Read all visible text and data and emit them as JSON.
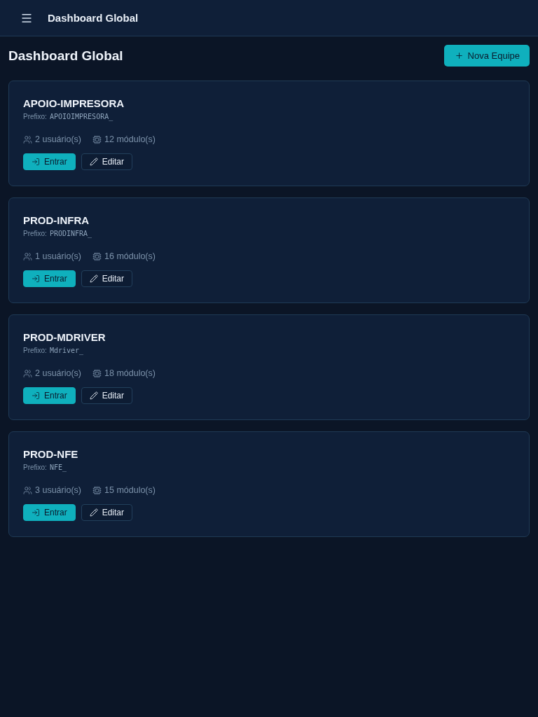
{
  "header": {
    "title": "Dashboard Global"
  },
  "page": {
    "title": "Dashboard Global",
    "new_button": "Nova Equipe"
  },
  "teams": [
    {
      "name": "APOIO-IMPRESORA",
      "prefix_label": "Prefixo:",
      "prefix": "APOIOIMPRESORA_",
      "users": "2 usuário(s)",
      "modules": "12 módulo(s)",
      "enter": "Entrar",
      "edit": "Editar"
    },
    {
      "name": "PROD-INFRA",
      "prefix_label": "Prefixo:",
      "prefix": "PRODINFRA_",
      "users": "1 usuário(s)",
      "modules": "16 módulo(s)",
      "enter": "Entrar",
      "edit": "Editar"
    },
    {
      "name": "PROD-MDRIVER",
      "prefix_label": "Prefixo:",
      "prefix": "Mdriver_",
      "users": "2 usuário(s)",
      "modules": "18 módulo(s)",
      "enter": "Entrar",
      "edit": "Editar"
    },
    {
      "name": "PROD-NFE",
      "prefix_label": "Prefixo:",
      "prefix": "NFE_",
      "users": "3 usuário(s)",
      "modules": "15 módulo(s)",
      "enter": "Entrar",
      "edit": "Editar"
    }
  ]
}
